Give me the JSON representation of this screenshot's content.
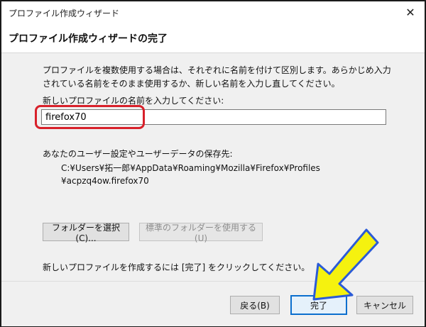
{
  "window": {
    "title": "プロファイル作成ウィザード",
    "close_glyph": "✕"
  },
  "header": {
    "title": "プロファイル作成ウィザードの完了"
  },
  "content": {
    "description": "プロファイルを複数使用する場合は、それぞれに名前を付けて区別します。あらかじめ入力されている名前をそのまま使用するか、新しい名前を入力し直してください。",
    "name_prompt": "新しいプロファイルの名前を入力してください:",
    "profile_name": "firefox70",
    "save_location_label": "あなたのユーザー設定やユーザーデータの保存先:",
    "path_line1": "C:¥Users¥拓一郎¥AppData¥Roaming¥Mozilla¥Firefox¥Profiles",
    "path_line2": "¥acpzq4ow.firefox70",
    "choose_folder_button": "フォルダーを選択(C)...",
    "default_folder_button": "標準のフォルダーを使用する(U)",
    "finish_hint": "新しいプロファイルを作成するには [完了] をクリックしてください。"
  },
  "footer": {
    "back_button": "戻る(B)",
    "finish_button": "完了",
    "cancel_button": "キャンセル"
  },
  "colors": {
    "highlight_border": "#d8202a",
    "arrow_fill": "#f5f20f",
    "arrow_stroke": "#2b5bd7",
    "primary_button_border": "#0b6fce"
  }
}
